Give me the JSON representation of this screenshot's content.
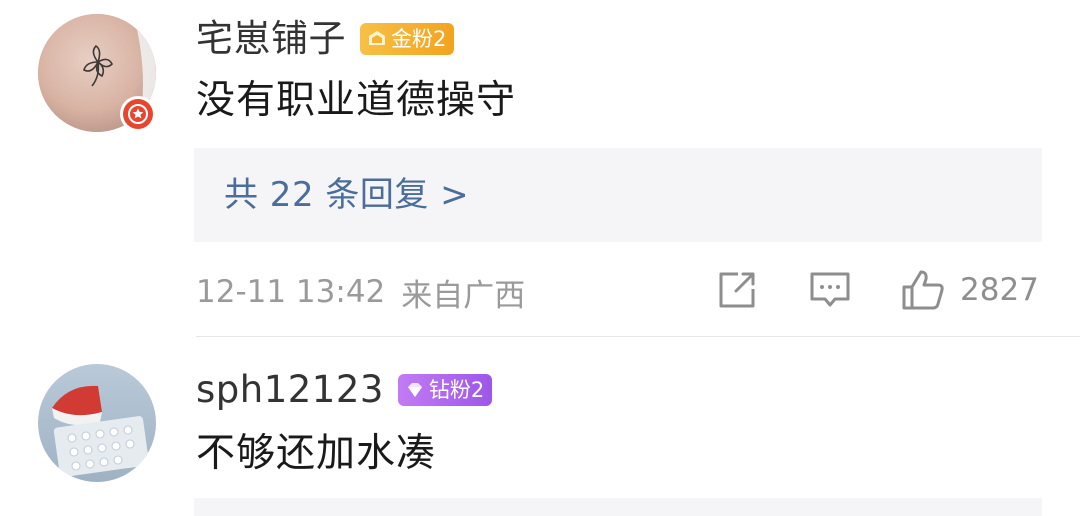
{
  "comments": [
    {
      "username": "宅崽铺子",
      "badge": {
        "label": "金粉2",
        "color": "#f4b232"
      },
      "text": "没有职业道德操守",
      "reply_link": "共 22 条回复 >",
      "timestamp": "12-11 13:42",
      "location": "来自广西",
      "likes": "2827",
      "icons": {
        "avatar_badge": "verified-star-icon",
        "share": "share-icon",
        "comment": "comment-icon",
        "like": "thumbs-up-icon"
      }
    },
    {
      "username": "sph12123",
      "badge": {
        "label": "钻粉2",
        "color": "#b06cef"
      },
      "text": "不够还加水凑"
    }
  ],
  "colors": {
    "reply_link": "#4a6d99",
    "reply_box_bg": "#f5f5f7",
    "meta_text": "#9a9a9a",
    "verified_badge": "#e8452f"
  }
}
